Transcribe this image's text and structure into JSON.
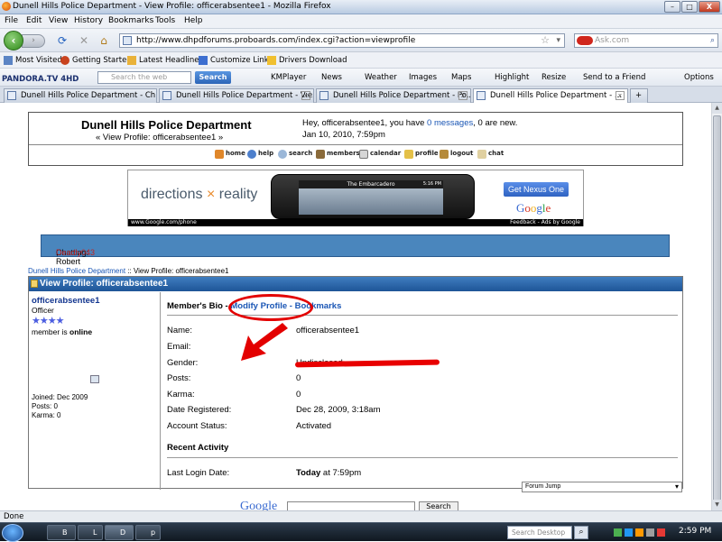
{
  "window": {
    "title": "Dunell Hills Police Department - View Profile: officerabsentee1 - Mozilla Firefox",
    "buttons": {
      "minimize": "–",
      "maximize": "□",
      "close": "X"
    }
  },
  "menu": [
    "File",
    "Edit",
    "View",
    "History",
    "Bookmarks",
    "Tools",
    "Help"
  ],
  "nav": {
    "url": "http://www.dhpdforums.proboards.com/index.cgi?action=viewprofile",
    "search_placeholder": "Ask.com"
  },
  "bookmarks": [
    "Most Visited",
    "Getting Started",
    "Latest Headlines",
    "Customize Links",
    "Drivers Download"
  ],
  "toolbar2": {
    "brand": "PANDORA.TV 4HD",
    "search_placeholder": "Search the web",
    "search_button": "Search",
    "items": [
      "KMPlayer",
      "News",
      "Weather",
      "Images",
      "Maps",
      "Highlight",
      "Resize",
      "Send to a Friend",
      "Options"
    ]
  },
  "tabs": [
    {
      "label": "Dunell Hills Police Department - Ch...",
      "active": false
    },
    {
      "label": "Dunell Hills Police Department - Vie...",
      "active": false
    },
    {
      "label": "Dunell Hills Police Department - Po...",
      "active": false
    },
    {
      "label": "Dunell Hills Police Department - ...",
      "active": true
    }
  ],
  "page": {
    "forum_name": "Dunell Hills Police Department",
    "subtitle": "« View Profile: officerabsentee1 »",
    "greeting_prefix": "Hey, officerabsentee1, you have ",
    "greeting_link": "0 messages",
    "greeting_suffix": ", 0 are new.",
    "date": "Jan 10, 2010, 7:59pm",
    "nav_links": [
      "home",
      "help",
      "search",
      "members",
      "calendar",
      "profile",
      "logout",
      "chat"
    ],
    "ad": {
      "text_left": "directions",
      "text_x": "×",
      "text_right": "reality",
      "phone_title": "The Embarcadero",
      "phone_time": "5:16 PM",
      "button": "Get Nexus One",
      "logo": "Google",
      "url": "www.Google.com/phone",
      "attrib": "Feedback - Ads by Google"
    },
    "chatting_label": "Chatting: ",
    "chatting_user1": "Deadly043",
    "chatting_user2": ", Robert",
    "crumb_link": "Dunell Hills Police Department",
    "crumb_rest": " :: View Profile: officerabsentee1",
    "profile_header": "View Profile: officerabsentee1",
    "user": {
      "name": "officerabsentee1",
      "rank": "Officer",
      "stars": "★★★★",
      "status_prefix": "member is ",
      "status": "online",
      "joined": "Joined: Dec 2009",
      "posts": "Posts: 0",
      "karma": "Karma: 0"
    },
    "bio_header": "Member's Bio - ",
    "modify_link": "Modify Profile",
    "bookmarks_link": " - Bookmarks",
    "fields": [
      {
        "label": "Name:",
        "value": "officerabsentee1"
      },
      {
        "label": "Email:",
        "value": ""
      },
      {
        "label": "Gender:",
        "value": "Undisclosed"
      },
      {
        "label": "Posts:",
        "value": "0"
      },
      {
        "label": "Karma:",
        "value": "0"
      },
      {
        "label": "Date Registered:",
        "value": "Dec 28, 2009, 3:18am"
      },
      {
        "label": "Account Status:",
        "value": "Activated"
      }
    ],
    "recent_activity": "Recent Activity",
    "last_login_label": "Last Login Date:",
    "last_login_bold": "Today",
    "last_login_time": " at 7:59pm",
    "forum_jump": "Forum Jump",
    "google_search_logo": "Google",
    "google_search_button": "Search"
  },
  "status": "Done",
  "taskbar": {
    "buttons": [
      "B",
      "L",
      "D",
      "p"
    ],
    "desktop_search": "Search Desktop",
    "clock": "2:59 PM"
  }
}
